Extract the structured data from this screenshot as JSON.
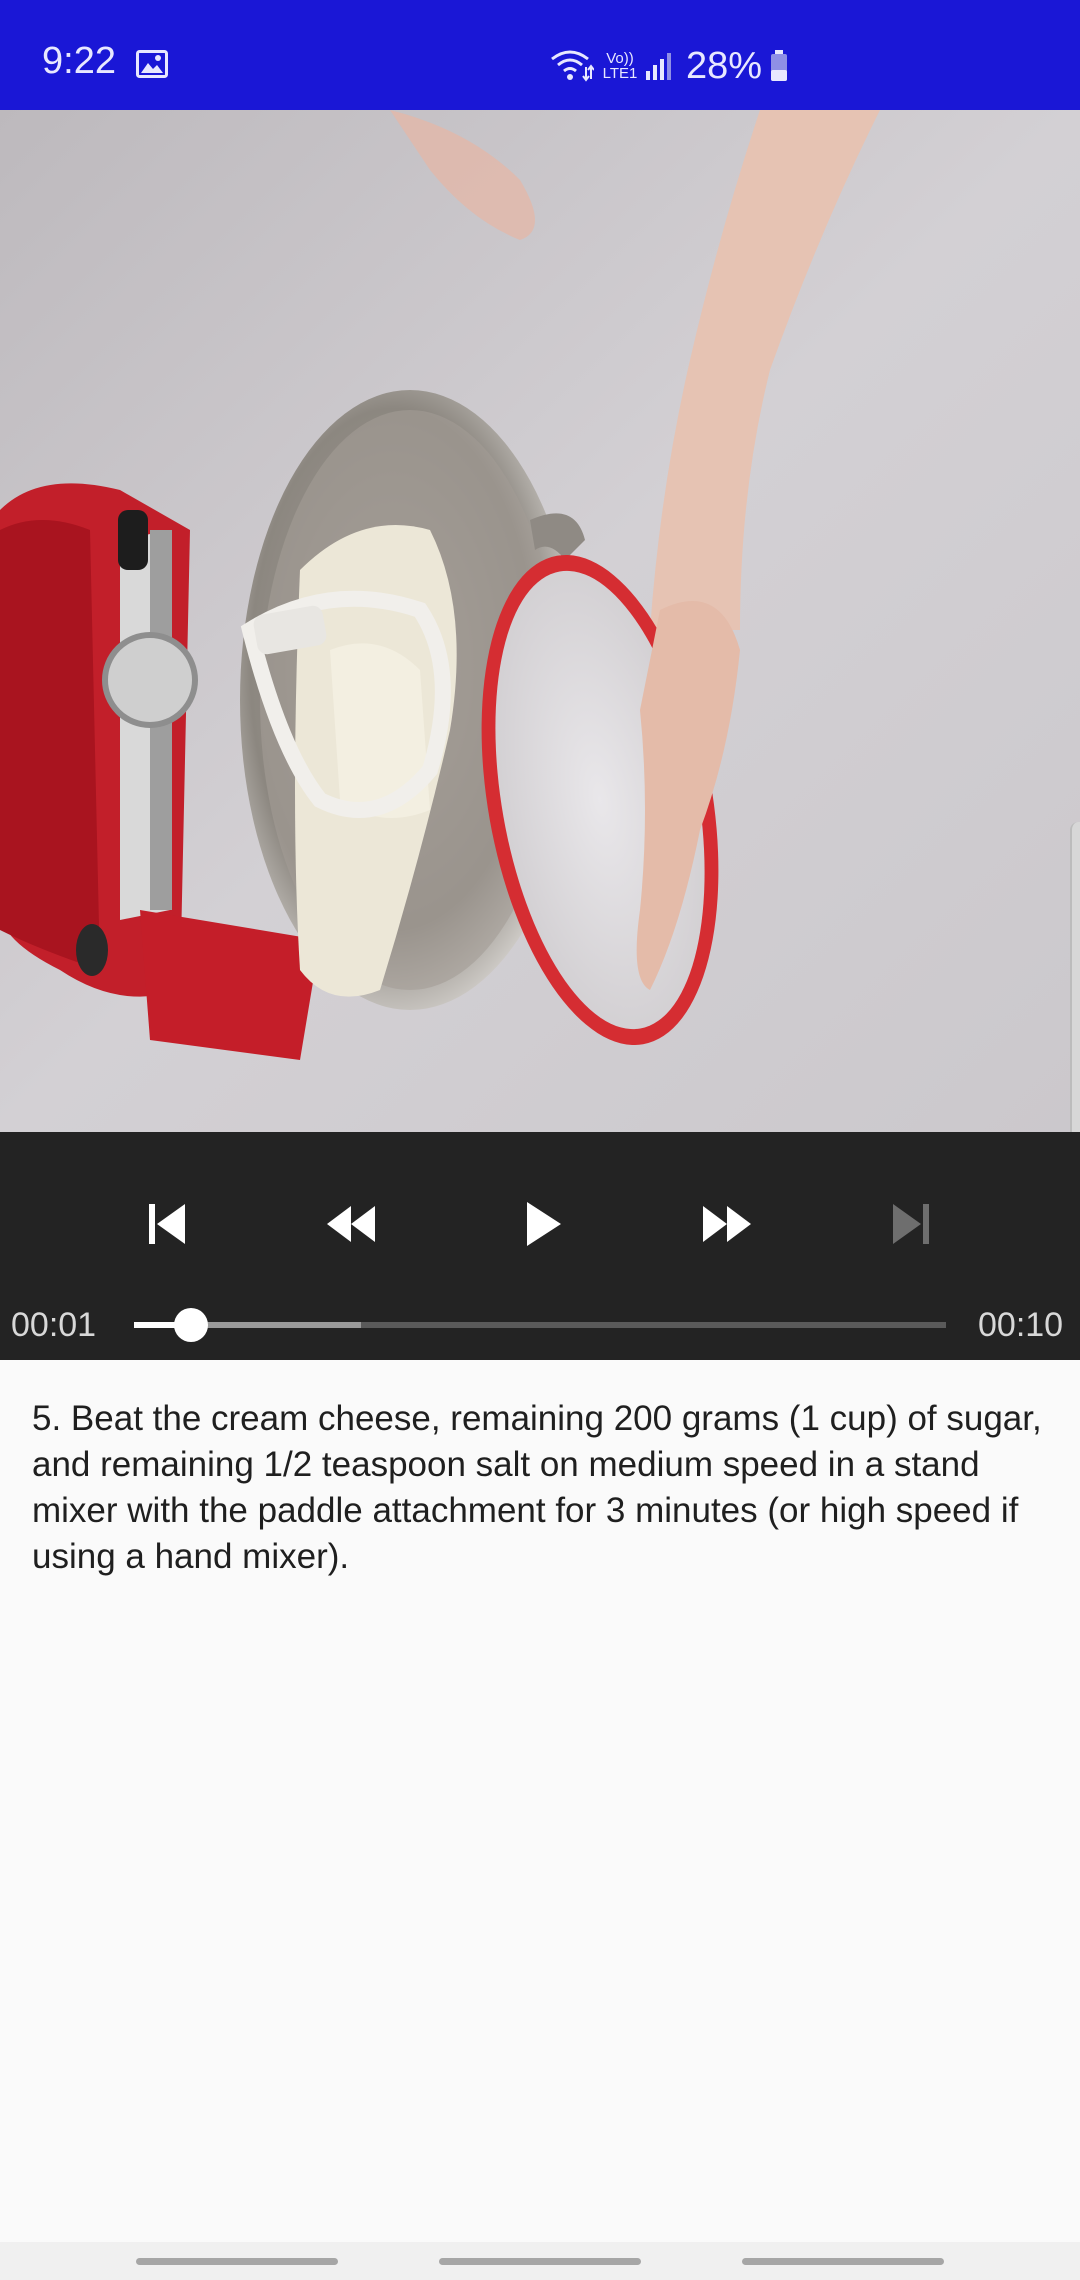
{
  "status_bar": {
    "time": "9:22",
    "network_label_top": "Vo))",
    "network_label_bottom": "LTE1",
    "battery": "28%",
    "icons": [
      "gallery-icon",
      "wifi-icon",
      "volte-icon",
      "signal-icon",
      "battery-icon"
    ],
    "background_color": "#1a17d6"
  },
  "video": {
    "description": "kitchen stand mixer with cream cheese, hand pouring sugar"
  },
  "player": {
    "current_time": "00:01",
    "total_time": "00:10",
    "progress": 0.07,
    "buffered": 0.28,
    "controls": [
      "skip-previous-icon",
      "rewind-icon",
      "play-icon",
      "fast-forward-icon",
      "skip-next-icon"
    ],
    "skip_next_enabled": false
  },
  "step": {
    "text": "5. Beat the cream cheese, remaining 200 grams (1 cup) of sugar, and remaining 1/2 teaspoon salt on medium speed in a stand mixer with the paddle attachment for 3 minutes (or high speed if using a hand mixer)."
  },
  "nav_bar": {
    "handles": [
      "recents",
      "home",
      "back"
    ]
  }
}
